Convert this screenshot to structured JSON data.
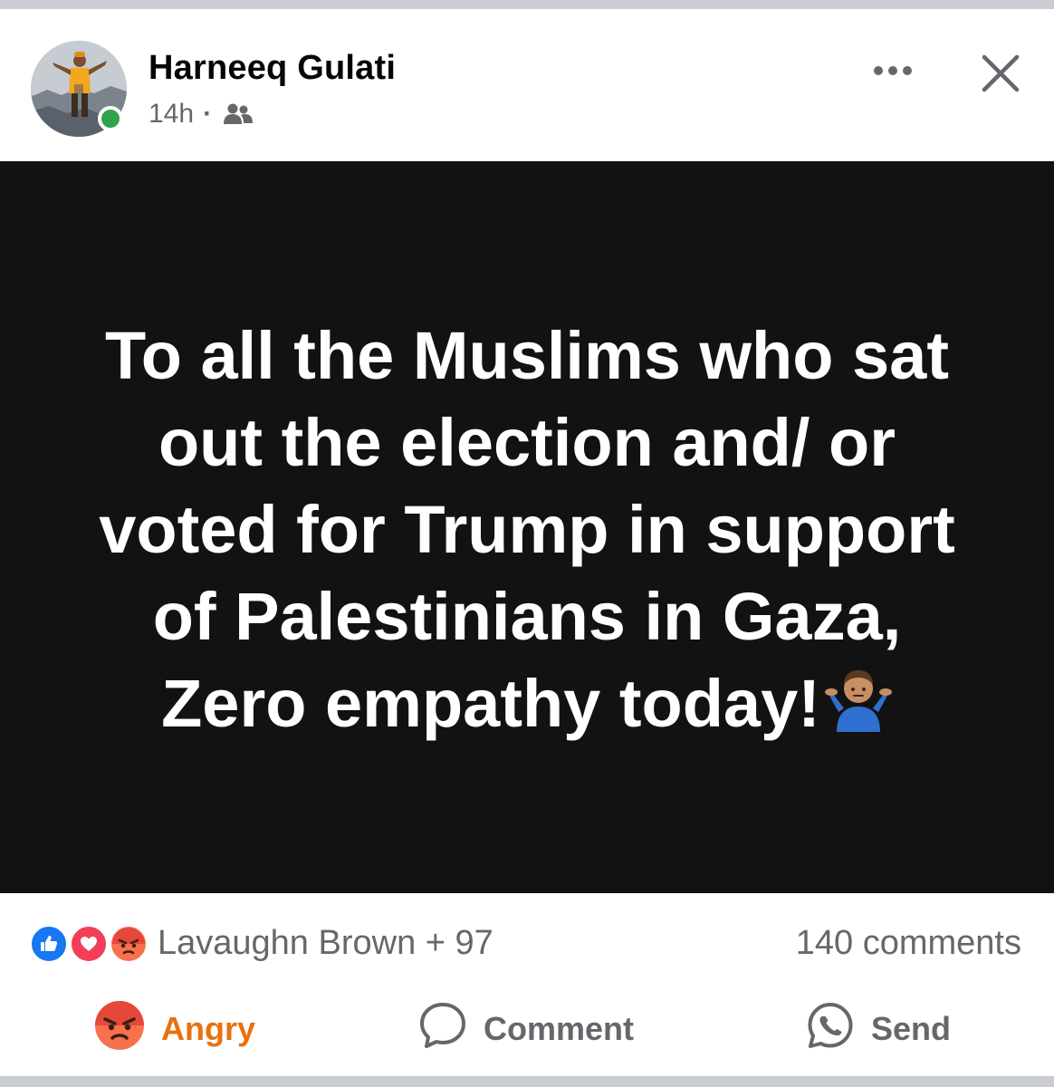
{
  "post": {
    "author": "Harneeq Gulati",
    "timestamp": "14h",
    "separator": "·",
    "audience_icon": "friends-icon",
    "text": "To all the Muslims who sat out the election and/ or voted for Trump in support of Palestinians in Gaza, Zero empathy today!",
    "text_emoji": "person-shrugging-emoji",
    "background_color": "#121212",
    "text_color": "#ffffff"
  },
  "header": {
    "more_icon": "more-options-icon",
    "close_icon": "close-icon",
    "online_status_color": "#31a24c"
  },
  "reactions": {
    "icons": [
      "like-icon",
      "love-icon",
      "angry-icon"
    ],
    "summary": "Lavaughn Brown + 97",
    "comments": "140 comments"
  },
  "actions": {
    "angry_label": "Angry",
    "comment_label": "Comment",
    "send_label": "Send",
    "angry_color": "#e9710f"
  }
}
